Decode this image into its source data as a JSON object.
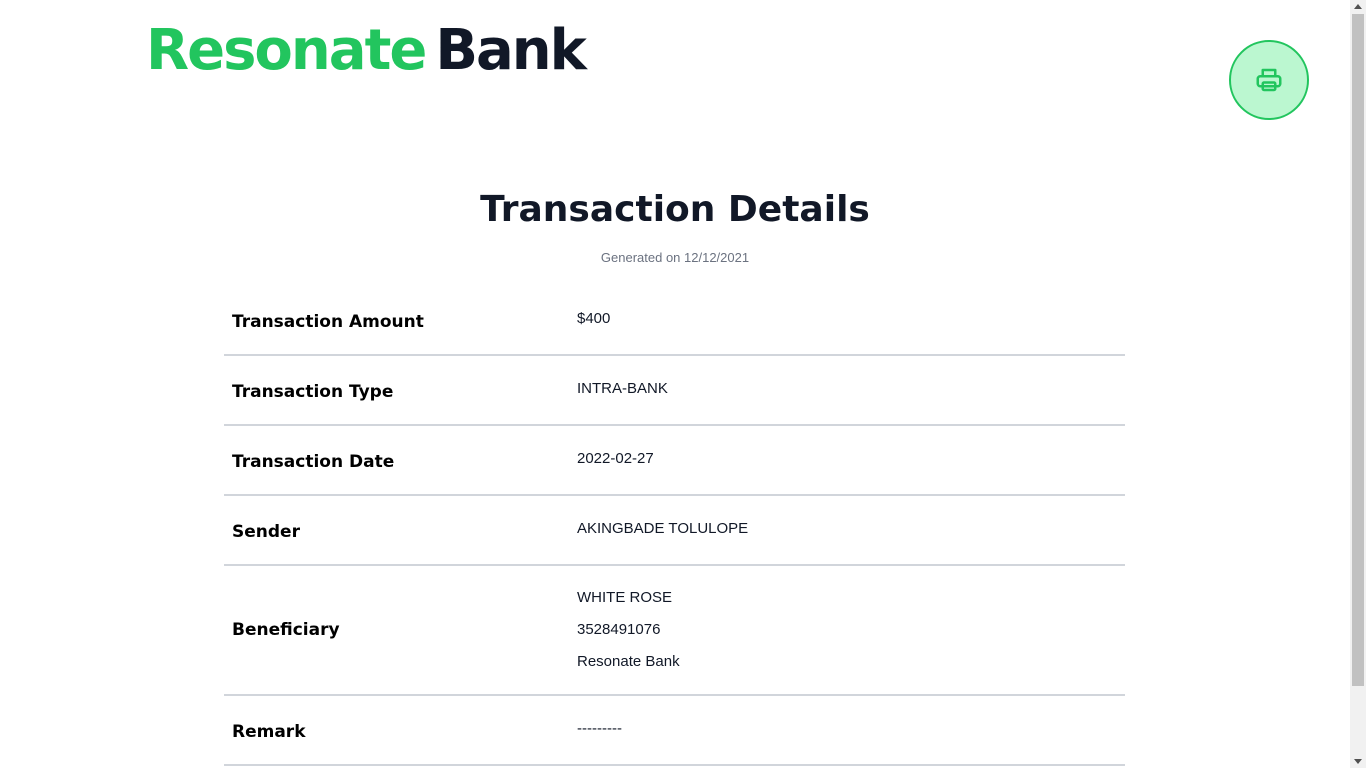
{
  "header": {
    "logo_primary": "Resonate",
    "logo_secondary": "Bank",
    "print_icon": "printer-icon"
  },
  "title": "Transaction Details",
  "subtitle": "Generated on 12/12/2021",
  "details": {
    "amount_label": "Transaction Amount",
    "amount_value": "$400",
    "type_label": "Transaction Type",
    "type_value": "INTRA-BANK",
    "date_label": "Transaction Date",
    "date_value": "2022-02-27",
    "sender_label": "Sender",
    "sender_value": "AKINGBADE TOLULOPE",
    "beneficiary_label": "Beneficiary",
    "beneficiary_name": "WHITE ROSE",
    "beneficiary_account": "3528491076",
    "beneficiary_bank": "Resonate Bank",
    "remark_label": "Remark",
    "remark_value": "---------"
  },
  "colors": {
    "brand_green": "#22c55e",
    "dark": "#111827",
    "print_bg": "#bbf7d0"
  }
}
